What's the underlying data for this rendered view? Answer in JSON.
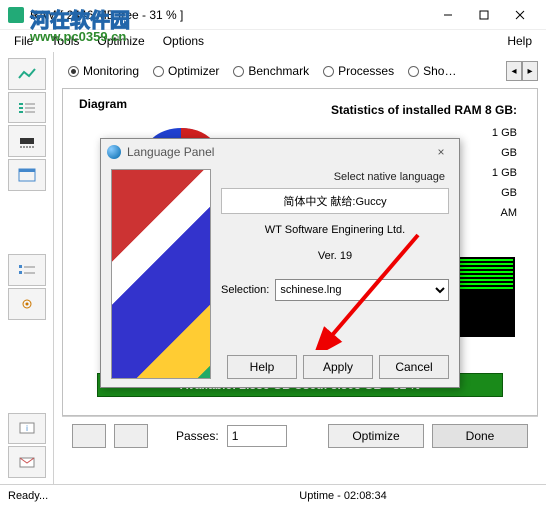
{
  "window": {
    "title": "RAM [ 2446 MB free - 31 % ]",
    "controls": {
      "min": "−",
      "max": "□",
      "close": "×"
    }
  },
  "menu": {
    "file": "File",
    "tools": "Tools",
    "optimize": "Optimize",
    "options": "Options",
    "help": "Help"
  },
  "watermark": {
    "text": "河在软件园",
    "url": "www.pc0359.cn"
  },
  "tabs": {
    "monitoring": "Monitoring",
    "optimizer": "Optimizer",
    "benchmark": "Benchmark",
    "processes": "Processes",
    "short": "Sho…"
  },
  "panel": {
    "diagram": "Diagram",
    "statsTitle": "Statistics of installed RAM 8 GB:",
    "rows": [
      "1 GB",
      "GB",
      "1 GB",
      "GB",
      "AM"
    ],
    "availText": "Available:  2.386 GB   Used:  5.505 GB - 31 %"
  },
  "bottom": {
    "passesLabel": "Passes:",
    "passesValue": "1",
    "optimize": "Optimize",
    "done": "Done"
  },
  "status": {
    "ready": "Ready...",
    "uptime": "Uptime  -  02:08:34"
  },
  "dialog": {
    "title": "Language Panel",
    "selectLabel": "Select native language",
    "line1": "简体中文  献给:Guccy",
    "line2": "WT Software Enginering Ltd.",
    "line3": "Ver. 19",
    "selectionLabel": "Selection:",
    "selected": "schinese.lng",
    "help": "Help",
    "apply": "Apply",
    "cancel": "Cancel"
  }
}
